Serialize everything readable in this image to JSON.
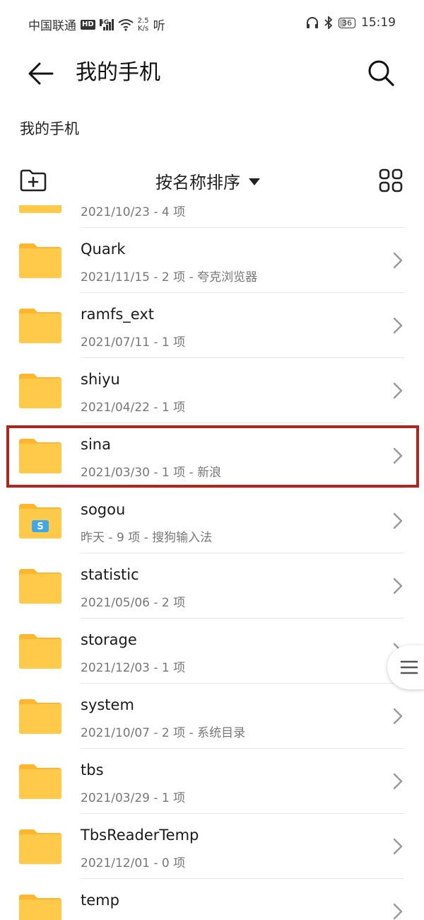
{
  "status_bar": {
    "carrier": "中国联通",
    "hd_badge": "HD",
    "network": "5G",
    "speed_value": "2.5",
    "speed_unit": "K/s",
    "extra": "听",
    "battery": "36",
    "time": "15:19"
  },
  "app_bar": {
    "title": "我的手机"
  },
  "breadcrumb": "我的手机",
  "sort": {
    "label": "按名称排序"
  },
  "files": [
    {
      "name": "",
      "meta": "2021/10/23 - 4 项",
      "special_icon": false,
      "highlighted": false
    },
    {
      "name": "Quark",
      "meta": "2021/11/15 - 2 项 - 夸克浏览器",
      "special_icon": false,
      "highlighted": false
    },
    {
      "name": "ramfs_ext",
      "meta": "2021/07/11 - 1 项",
      "special_icon": false,
      "highlighted": false
    },
    {
      "name": "shiyu",
      "meta": "2021/04/22 - 1 项",
      "special_icon": false,
      "highlighted": false
    },
    {
      "name": "sina",
      "meta": "2021/03/30 - 1 项 - 新浪",
      "special_icon": false,
      "highlighted": true
    },
    {
      "name": "sogou",
      "meta": "昨天 - 9 项 - 搜狗输入法",
      "special_icon": true,
      "highlighted": false
    },
    {
      "name": "statistic",
      "meta": "2021/05/06 - 2 项",
      "special_icon": false,
      "highlighted": false
    },
    {
      "name": "storage",
      "meta": "2021/12/03 - 1 项",
      "special_icon": false,
      "highlighted": false
    },
    {
      "name": "system",
      "meta": "2021/10/07 - 2 项 - 系统目录",
      "special_icon": false,
      "highlighted": false
    },
    {
      "name": "tbs",
      "meta": "2021/03/29 - 1 项",
      "special_icon": false,
      "highlighted": false
    },
    {
      "name": "TbsReaderTemp",
      "meta": "2021/12/01 - 0 项",
      "special_icon": false,
      "highlighted": false
    },
    {
      "name": "temp",
      "meta": "",
      "special_icon": false,
      "highlighted": false
    }
  ],
  "colors": {
    "folder": "#FFC94A",
    "folder_tab": "#FFB52E",
    "highlight_border": "#B3241D",
    "sogou_badge": "#3FA8E8"
  },
  "icons": {
    "back": "back-arrow-icon",
    "search": "search-icon",
    "new_folder": "new-folder-icon",
    "sort_caret": "caret-down-icon",
    "grid": "grid-view-icon",
    "folder": "folder-icon",
    "chevron": "chevron-right-icon",
    "handle": "menu-lines-icon"
  }
}
